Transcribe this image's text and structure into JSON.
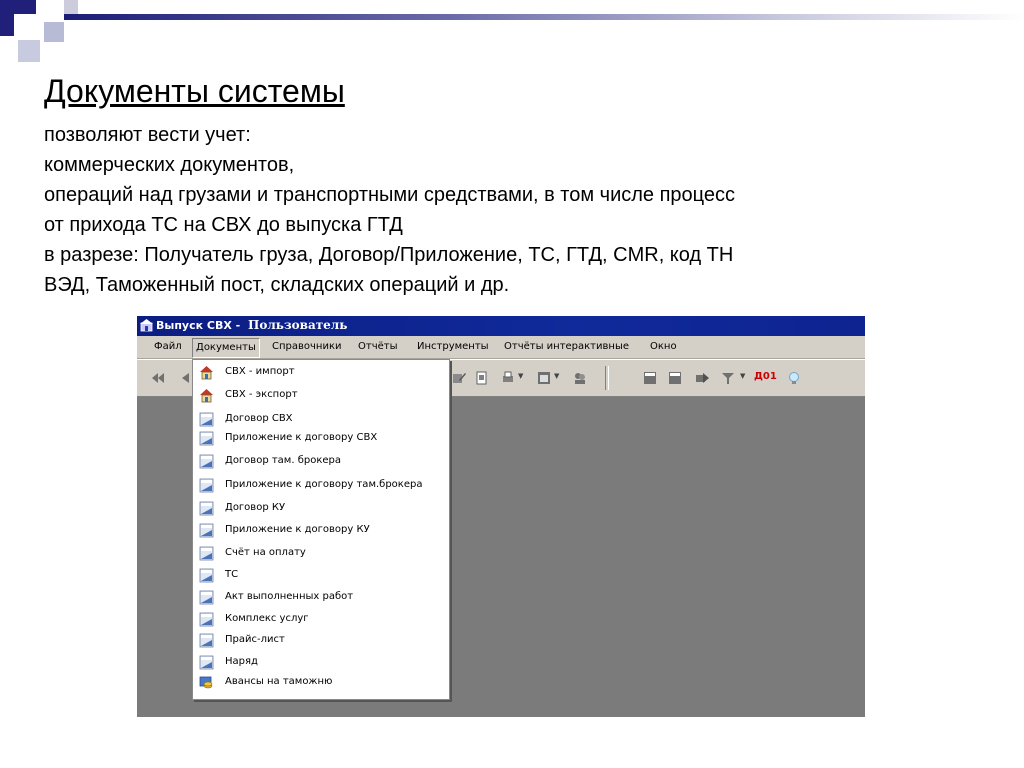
{
  "slide": {
    "title": "Документы системы",
    "lines": [
      "позволяют вести учет:",
      "коммерческих документов,",
      "операций над грузами и транспортными средствами, в том числе процесс",
      "от прихода ТС на СВХ до выпуска ГТД",
      "в разрезе: Получатель груза, Договор/Приложение, ТС, ГТД, CMR, код ТН",
      "ВЭД, Таможенный пост, складских операций и др."
    ]
  },
  "window": {
    "app_title": "Выпуск СВХ -",
    "user": "Пользователь",
    "menu": [
      {
        "label": "Файл"
      },
      {
        "label": "Документы"
      },
      {
        "label": "Справочники"
      },
      {
        "label": "Отчёты"
      },
      {
        "label": "Инструменты"
      },
      {
        "label": "Отчёты интерактивные"
      },
      {
        "label": "Окно"
      }
    ],
    "toolbar_badge": "Д01",
    "dropdown_items": [
      {
        "label": "СВХ - импорт",
        "icon": "house-icon"
      },
      {
        "label": "СВХ - экспорт",
        "icon": "house-icon"
      },
      {
        "label": "Договор СВХ",
        "icon": "document-icon"
      },
      {
        "label": "Приложение к договору СВХ",
        "icon": "document-icon"
      },
      {
        "label": "Договор там. брокера",
        "icon": "document-icon"
      },
      {
        "label": "Приложение к договору там.брокера",
        "icon": "document-icon"
      },
      {
        "label": "Договор КУ",
        "icon": "document-icon"
      },
      {
        "label": "Приложение к договору КУ",
        "icon": "document-icon"
      },
      {
        "label": "Счёт на оплату",
        "icon": "document-icon"
      },
      {
        "label": "ТС",
        "icon": "document-icon"
      },
      {
        "label": "Акт выполненных работ",
        "icon": "document-icon"
      },
      {
        "label": "Комплекс услуг",
        "icon": "document-icon"
      },
      {
        "label": "Прайс-лист",
        "icon": "document-icon"
      },
      {
        "label": "Наряд",
        "icon": "document-icon"
      },
      {
        "label": "Авансы на таможню",
        "icon": "coins-icon"
      }
    ]
  }
}
